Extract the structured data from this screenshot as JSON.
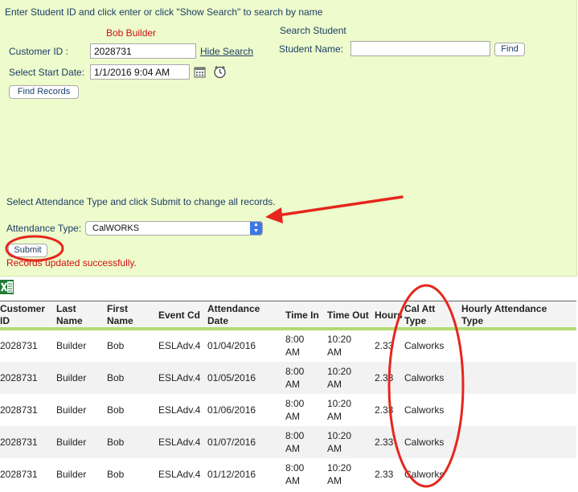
{
  "search_panel": {
    "instruction": "Enter Student ID and click enter or click \"Show Search\" to search by name",
    "student_display_name": "Bob Builder",
    "customer_id_label": "Customer ID :",
    "customer_id_value": "2028731",
    "hide_search_link": "Hide Search",
    "start_date_label": "Select Start Date:",
    "start_date_value": "1/1/2016 9:04 AM",
    "find_records_button": "Find Records",
    "search_student_title": "Search Student",
    "student_name_label": "Student Name:",
    "student_name_value": "",
    "find_button": "Find"
  },
  "attendance_panel": {
    "instruction": "Select Attendance Type and click Submit to change all records.",
    "type_label": "Attendance Type:",
    "type_value": "CalWORKS",
    "submit_button": "Submit",
    "status_message": "Records updated successfully."
  },
  "icons": {
    "export": "excel-export-icon",
    "calendar": "calendar-icon",
    "clock": "clock-icon"
  },
  "table": {
    "columns": [
      {
        "key": "customer_id",
        "label": "Customer ID"
      },
      {
        "key": "last_name",
        "label": "Last Name"
      },
      {
        "key": "first_name",
        "label": "First Name"
      },
      {
        "key": "event_cd",
        "label": "Event Cd"
      },
      {
        "key": "attendance_date",
        "label": "Attendance Date"
      },
      {
        "key": "time_in",
        "label": "Time In"
      },
      {
        "key": "time_out",
        "label": "Time Out"
      },
      {
        "key": "hours",
        "label": "Hours"
      },
      {
        "key": "cal_att_type",
        "label": "Cal Att Type"
      },
      {
        "key": "hourly_attendance_type",
        "label": "Hourly Attendance Type"
      }
    ],
    "rows": [
      {
        "customer_id": "2028731",
        "last_name": "Builder",
        "first_name": "Bob",
        "event_cd": "ESLAdv.4",
        "attendance_date": "01/04/2016",
        "time_in": "8:00 AM",
        "time_out": "10:20 AM",
        "hours": "2.33",
        "cal_att_type": "Calworks",
        "hourly_attendance_type": ""
      },
      {
        "customer_id": "2028731",
        "last_name": "Builder",
        "first_name": "Bob",
        "event_cd": "ESLAdv.4",
        "attendance_date": "01/05/2016",
        "time_in": "8:00 AM",
        "time_out": "10:20 AM",
        "hours": "2.33",
        "cal_att_type": "Calworks",
        "hourly_attendance_type": ""
      },
      {
        "customer_id": "2028731",
        "last_name": "Builder",
        "first_name": "Bob",
        "event_cd": "ESLAdv.4",
        "attendance_date": "01/06/2016",
        "time_in": "8:00 AM",
        "time_out": "10:20 AM",
        "hours": "2.33",
        "cal_att_type": "Calworks",
        "hourly_attendance_type": ""
      },
      {
        "customer_id": "2028731",
        "last_name": "Builder",
        "first_name": "Bob",
        "event_cd": "ESLAdv.4",
        "attendance_date": "01/07/2016",
        "time_in": "8:00 AM",
        "time_out": "10:20 AM",
        "hours": "2.33",
        "cal_att_type": "Calworks",
        "hourly_attendance_type": ""
      },
      {
        "customer_id": "2028731",
        "last_name": "Builder",
        "first_name": "Bob",
        "event_cd": "ESLAdv.4",
        "attendance_date": "01/12/2016",
        "time_in": "8:00 AM",
        "time_out": "10:20 AM",
        "hours": "2.33",
        "cal_att_type": "Calworks",
        "hourly_attendance_type": ""
      }
    ]
  },
  "colors": {
    "panel_bg": "#eefbcc",
    "accent_green": "#b2dc72",
    "annotation_red": "#e5261c",
    "link_blue": "#1a3e66"
  }
}
